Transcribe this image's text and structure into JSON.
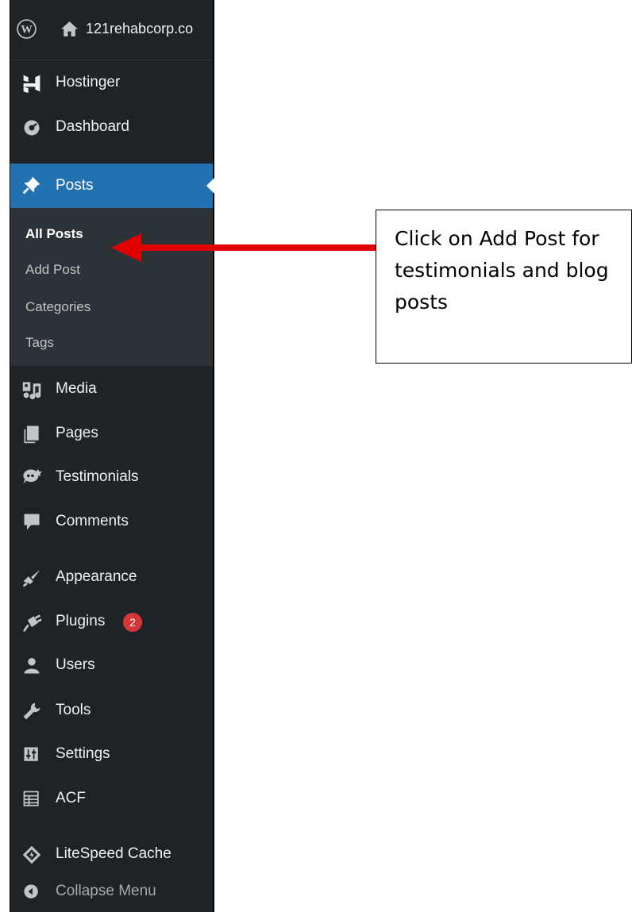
{
  "admin_bar": {
    "site_name": "121rehabcorp.co"
  },
  "menu": {
    "hostinger": "Hostinger",
    "dashboard": "Dashboard",
    "posts": "Posts",
    "posts_submenu": {
      "all_posts": "All Posts",
      "add_post": "Add Post",
      "categories": "Categories",
      "tags": "Tags"
    },
    "media": "Media",
    "pages": "Pages",
    "testimonials": "Testimonials",
    "comments": "Comments",
    "appearance": "Appearance",
    "plugins": "Plugins",
    "plugins_badge": "2",
    "users": "Users",
    "tools": "Tools",
    "settings": "Settings",
    "acf": "ACF",
    "litespeed": "LiteSpeed Cache",
    "collapse": "Collapse Menu"
  },
  "callout": {
    "text": "Click on Add Post for testimonials and blog posts"
  },
  "colors": {
    "sidebar_bg": "#1d2327",
    "submenu_bg": "#2c3338",
    "active_blue": "#2271b1",
    "badge_red": "#d63638",
    "arrow_red": "#e00000"
  }
}
